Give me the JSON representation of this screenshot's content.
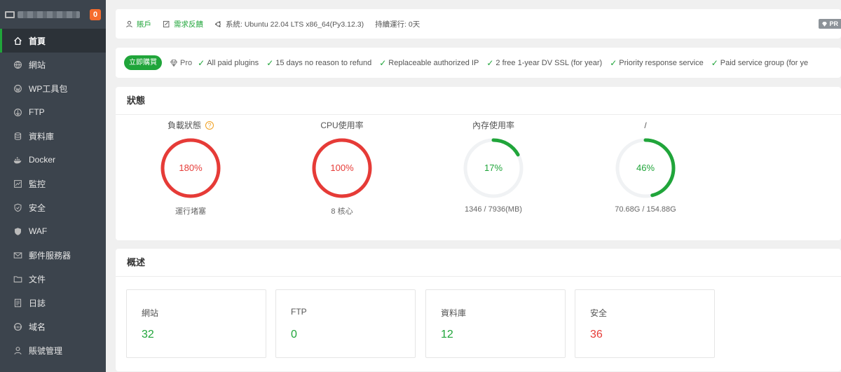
{
  "sidebar": {
    "badge": "0",
    "items": [
      {
        "label": "首頁",
        "icon": "home-icon"
      },
      {
        "label": "網站",
        "icon": "globe-icon"
      },
      {
        "label": "WP工具包",
        "icon": "wordpress-icon"
      },
      {
        "label": "FTP",
        "icon": "ftp-icon"
      },
      {
        "label": "資料庫",
        "icon": "database-icon"
      },
      {
        "label": "Docker",
        "icon": "docker-icon"
      },
      {
        "label": "監控",
        "icon": "monitor-icon"
      },
      {
        "label": "安全",
        "icon": "shield-icon"
      },
      {
        "label": "WAF",
        "icon": "waf-shield-icon"
      },
      {
        "label": "郵件服務器",
        "icon": "mail-icon"
      },
      {
        "label": "文件",
        "icon": "folder-icon"
      },
      {
        "label": "日誌",
        "icon": "log-icon"
      },
      {
        "label": "域名",
        "icon": "domain-icon"
      },
      {
        "label": "賬號管理",
        "icon": "user-icon"
      }
    ]
  },
  "topbar": {
    "account": "賬戶",
    "feedback": "需求反饋",
    "system": "系統: Ubuntu 22.04 LTS x86_64(Py3.12.3)",
    "uptime": "持續運行: 0天",
    "pro_chip": "PR"
  },
  "probar": {
    "buy_label": "立即購買",
    "pro_label": "Pro",
    "features": [
      "All paid plugins",
      "15 days no reason to refund",
      "Replaceable authorized IP",
      "2 free 1-year DV SSL (for year)",
      "Priority response service",
      "Paid service group (for ye"
    ]
  },
  "status": {
    "title": "狀態",
    "gauges": [
      {
        "title": "負載狀態",
        "value": "180%",
        "percent": 100,
        "sub": "運行堵塞",
        "color": "#e63b37"
      },
      {
        "title": "CPU使用率",
        "value": "100%",
        "percent": 100,
        "sub": "8 核心",
        "color": "#e63b37"
      },
      {
        "title": "內存使用率",
        "value": "17%",
        "percent": 17,
        "sub": "1346 / 7936(MB)",
        "color": "#20a53a"
      },
      {
        "title": "/",
        "value": "46%",
        "percent": 46,
        "sub": "70.68G / 154.88G",
        "color": "#20a53a"
      }
    ]
  },
  "overview": {
    "title": "概述",
    "cards": [
      {
        "label": "網站",
        "value": "32"
      },
      {
        "label": "FTP",
        "value": "0"
      },
      {
        "label": "資料庫",
        "value": "12"
      },
      {
        "label": "安全",
        "value": "36"
      }
    ]
  },
  "colors": {
    "accent": "#20a53a",
    "danger": "#e63b37",
    "sidebar": "#3c444d"
  }
}
